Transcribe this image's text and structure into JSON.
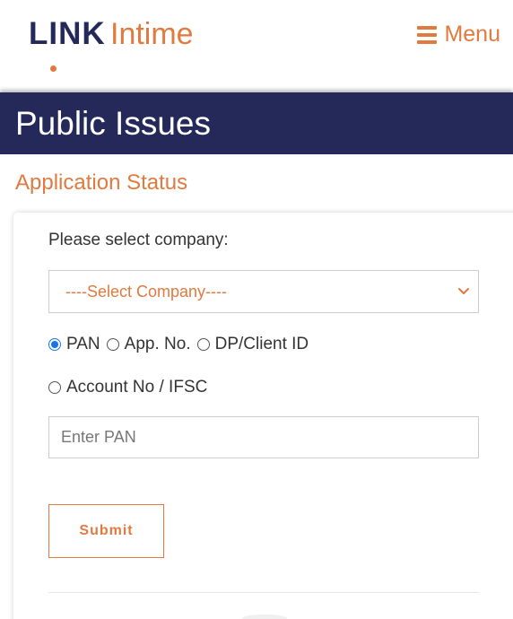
{
  "header": {
    "logo_primary": "LINK",
    "logo_secondary": "Intime",
    "menu_label": "Menu",
    "menu_icon": "hamburger-icon"
  },
  "band": {
    "title": "Public Issues"
  },
  "page": {
    "subtitle": "Application Status"
  },
  "form": {
    "select_label": "Please select company:",
    "select_value": "----Select Company----",
    "search_types": [
      {
        "label": "PAN",
        "checked": true
      },
      {
        "label": "App. No.",
        "checked": false
      },
      {
        "label": "DP/Client ID",
        "checked": false
      },
      {
        "label": "Account No / IFSC",
        "checked": false
      }
    ],
    "input_placeholder": "Enter PAN",
    "submit_label": "Submit"
  },
  "colors": {
    "brand_navy": "#25295a",
    "brand_orange": "#e07a3f",
    "radio_accent": "#1a73e8"
  }
}
